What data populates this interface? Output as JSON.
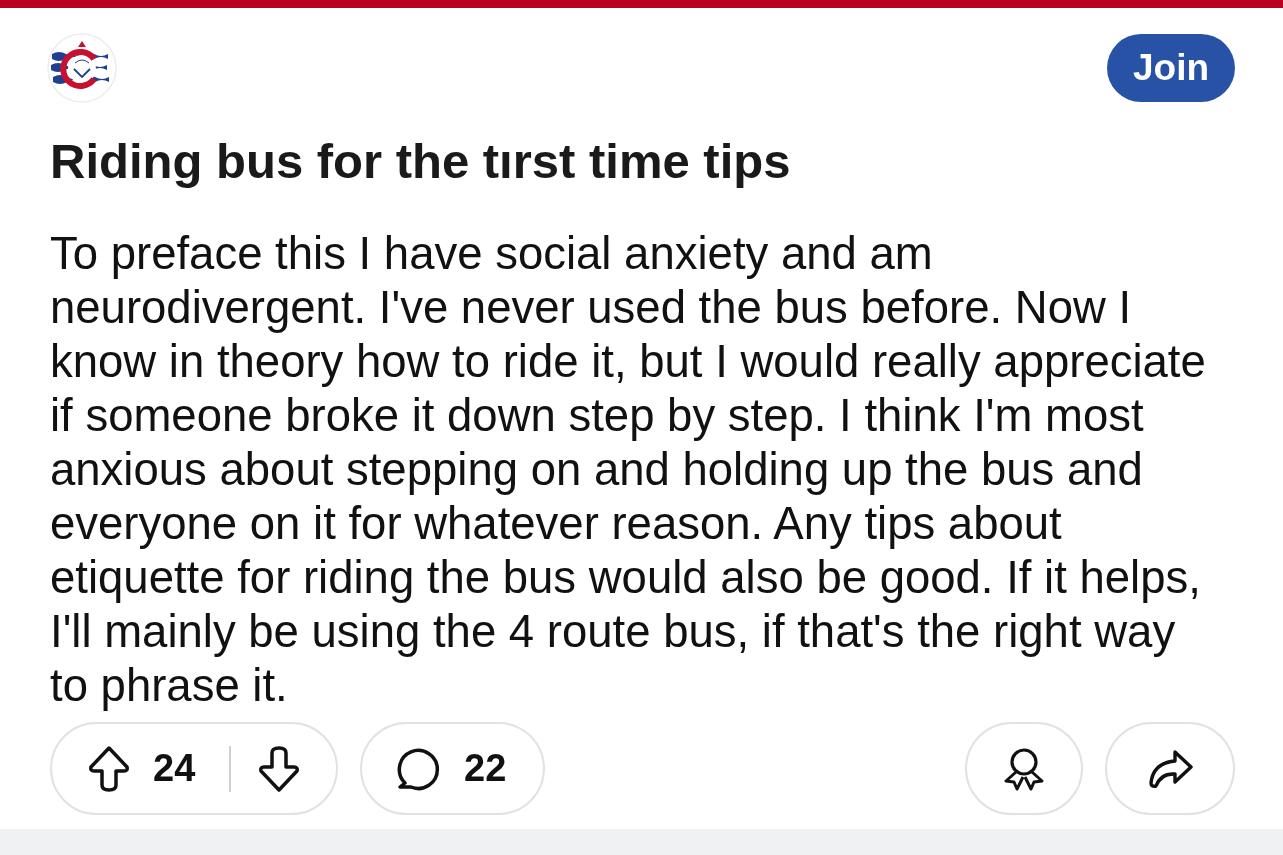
{
  "header": {
    "join_button": "Join"
  },
  "post": {
    "title": "Riding bus for the tırst time tips",
    "body_lines": [
      "To preface this I have social anxiety and am",
      "neurodivergent. I've never used the bus before. Now I",
      "know in theory how to ride it, but I would really appreciate",
      "if someone broke it down step by step. I think I'm most",
      "anxious about stepping on and holding up the bus and",
      "everyone on it for whatever reason. Any tips about",
      "etiquette for riding the bus would also be good. If it helps,",
      "I'll mainly be using the 4 route bus, if that's the right way",
      "to phrase it."
    ]
  },
  "actions": {
    "upvotes": "24",
    "comments": "22"
  }
}
